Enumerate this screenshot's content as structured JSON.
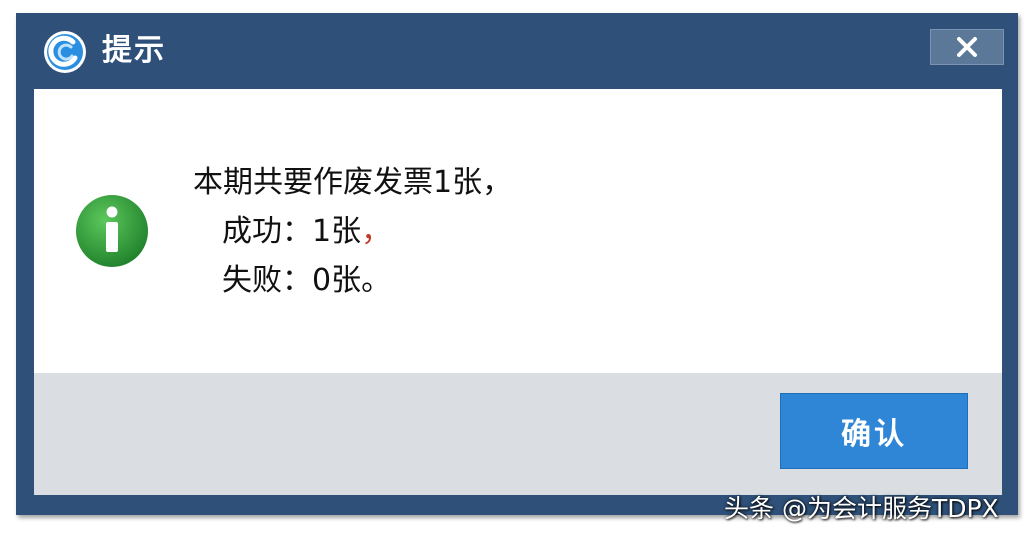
{
  "dialog": {
    "title": "提示",
    "close_symbol": "✕",
    "icons": {
      "app_logo": "app-logo-icon",
      "info": "info-icon",
      "close": "close-icon"
    },
    "colors": {
      "frame": "#2e5079",
      "info_green": "#2f9a3a",
      "button": "#2f86d6"
    },
    "message": {
      "line1": "本期共要作废发票1张，",
      "line2": "成功：1张",
      "line2_comma": "，",
      "line3": "失败：0张。"
    },
    "confirm_label": "确认"
  },
  "watermark": "头条 @为会计服务TDPX"
}
